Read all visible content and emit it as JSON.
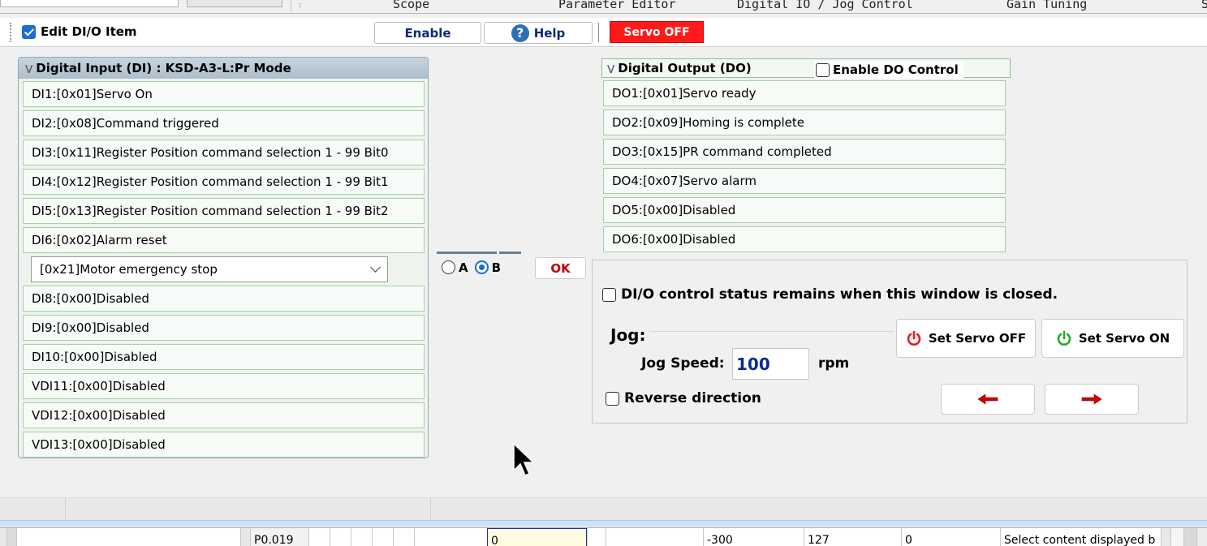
{
  "tabs": [
    "Scope",
    "Parameter Editor",
    "Digital IO / Jog Control",
    "Gain Tuning",
    "S"
  ],
  "toolbar": {
    "edit_label": "Edit DI/O Item",
    "edit_checked": true,
    "enable_label": "Enable",
    "help_label": "Help",
    "servo_status": "Servo OFF"
  },
  "di": {
    "title": "Digital Input (DI) : KSD-A3-L:Pr Mode",
    "rows": [
      "DI1:[0x01]Servo On",
      "DI2:[0x08]Command triggered",
      "DI3:[0x11]Register Position command selection 1 - 99 Bit0",
      "DI4:[0x12]Register Position command selection 1 - 99 Bit1",
      "DI5:[0x13]Register Position command selection 1 - 99 Bit2",
      "DI6:[0x02]Alarm reset"
    ],
    "di7_selected": "[0x21]Motor emergency stop",
    "rows_after": [
      "DI8:[0x00]Disabled",
      "DI9:[0x00]Disabled",
      "DI10:[0x00]Disabled",
      "VDI11:[0x00]Disabled",
      "VDI12:[0x00]Disabled",
      "VDI13:[0x00]Disabled"
    ]
  },
  "ab": {
    "a_label": "A",
    "b_label": "B",
    "selected": "B"
  },
  "ok_label": "OK",
  "do": {
    "title": "Digital Output (DO)",
    "enable_control_label": "Enable DO Control",
    "enable_control_checked": false,
    "rows": [
      "DO1:[0x01]Servo ready",
      "DO2:[0x09]Homing is complete",
      "DO3:[0x15]PR command completed",
      "DO4:[0x07]Servo alarm",
      "DO5:[0x00]Disabled",
      "DO6:[0x00]Disabled"
    ]
  },
  "control": {
    "remain_label": "DI/O control status remains when this window is closed.",
    "remain_checked": false,
    "jog_title": "Jog:",
    "jog_speed_label": "Jog Speed:",
    "jog_speed_value": "100",
    "jog_speed_unit": "rpm",
    "reverse_label": "Reverse direction",
    "reverse_checked": false,
    "set_servo_off_label": "Set Servo OFF",
    "set_servo_on_label": "Set Servo ON"
  },
  "grid": {
    "cells": [
      "P0.019",
      "0",
      "-300",
      "127",
      "0",
      "Select content displayed b"
    ]
  },
  "colors": {
    "servo_off_bg": "#ff1a1a",
    "servo_off_icon": "#e02020",
    "servo_on_icon": "#22aa33",
    "arrow_red": "#d00000",
    "accent_blue": "#1c6fd1"
  }
}
